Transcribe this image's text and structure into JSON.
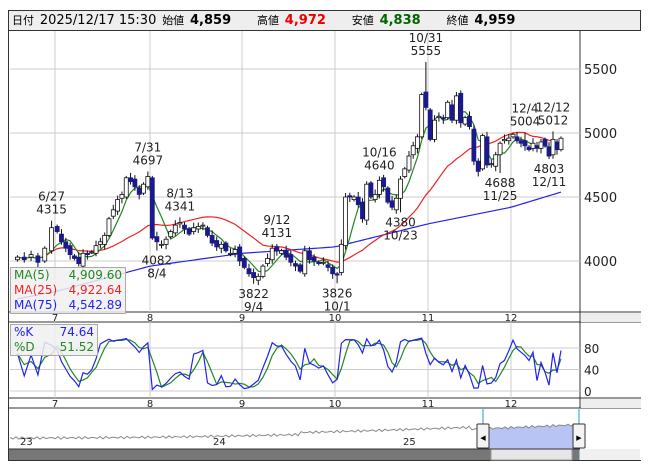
{
  "header": {
    "date_label": "日付",
    "date_value": "2025/12/17 15:30",
    "open_label": "始値",
    "open_value": "4,859",
    "high_label": "高値",
    "high_value": "4,972",
    "low_label": "安値",
    "low_value": "4,838",
    "close_label": "終値",
    "close_value": "4,959"
  },
  "colors": {
    "up_candle": "#ffffff",
    "down_candle": "#1a1a8c",
    "ma5": "#228822",
    "ma25": "#ee2222",
    "ma75": "#2222ee",
    "stoch_k": "#2222ee",
    "stoch_d": "#228822",
    "high_value": "#ee0000",
    "low_value": "#006600",
    "navigator_fill": "#b8c4f4"
  },
  "main_legend": [
    {
      "name": "MA(5)",
      "value": "4,909.60",
      "color": "#228822"
    },
    {
      "name": "MA(25)",
      "value": "4,922.64",
      "color": "#ee2222"
    },
    {
      "name": "MA(75)",
      "value": "4,542.89",
      "color": "#2222ee"
    }
  ],
  "stoch_legend": [
    {
      "name": "%K",
      "value": "74.64",
      "color": "#2222ee"
    },
    {
      "name": "%D",
      "value": "51.52",
      "color": "#228822"
    }
  ],
  "price_axis": {
    "ticks": [
      4000,
      4500,
      5000,
      5500
    ],
    "labels": [
      "4000",
      "4500",
      "5000",
      "5500"
    ]
  },
  "stoch_axis": {
    "ticks": [
      0,
      40,
      80
    ],
    "labels": [
      "0",
      "40",
      "80"
    ]
  },
  "month_labels": [
    "7",
    "8",
    "9",
    "10",
    "11",
    "12"
  ],
  "navigator": {
    "year_labels": [
      "23",
      "24",
      "25"
    ]
  },
  "chart_data": {
    "type": "candlestick",
    "months": [
      {
        "month": "6",
        "closes": [
          4030,
          4010,
          4050,
          3990,
          4100,
          4260
        ]
      },
      {
        "month": "7",
        "closes": [
          4230,
          4150,
          4100,
          4050,
          4020,
          3980,
          4060,
          4050,
          4070,
          4120,
          4150,
          4200,
          4330,
          4400,
          4480,
          4520,
          4650,
          4620,
          4580,
          4520,
          4600,
          4660
        ]
      },
      {
        "month": "8",
        "closes": [
          4180,
          4150,
          4130,
          4170,
          4230,
          4280,
          4300,
          4250,
          4210,
          4260,
          4270,
          4280,
          4200,
          4140,
          4110,
          4130,
          4080,
          4060,
          4090,
          4000
        ]
      },
      {
        "month": "9",
        "closes": [
          3950,
          3900,
          3870,
          3880,
          3960,
          4020,
          4100,
          4080,
          4080,
          4030,
          3990,
          3960,
          3920,
          4080,
          4010,
          4000,
          3980,
          3990,
          3950,
          3900
        ]
      },
      {
        "month": "10",
        "closes": [
          3890,
          4130,
          4500,
          4500,
          4500,
          4440,
          4330,
          4600,
          4500,
          4520,
          4630,
          4580,
          4460,
          4420,
          4490,
          4640,
          4720,
          4820,
          4900,
          4970,
          5300,
          5200
        ]
      },
      {
        "month": "11",
        "closes": [
          4950,
          5100,
          5130,
          5110,
          5240,
          5100,
          5290,
          5080,
          5120,
          5050,
          4780,
          4700,
          4980,
          4750,
          4760,
          4830,
          4920,
          4950,
          4960
        ]
      },
      {
        "month": "12",
        "closes": [
          4990,
          4940,
          4920,
          4900,
          4870,
          4920,
          4880,
          4930,
          4900,
          4820,
          4950,
          4870,
          4959
        ]
      }
    ],
    "ma75_anchors": [
      3700,
      3760,
      3960,
      4060,
      4110,
      4290,
      4420,
      4543
    ],
    "annotations": [
      {
        "month": "6",
        "day_index": 5,
        "date": "6/27",
        "value": "4315",
        "kind": "high"
      },
      {
        "month": "7",
        "day_index": 21,
        "date": "7/31",
        "value": "4697",
        "kind": "high"
      },
      {
        "month": "8",
        "day_index": 1,
        "date": "8/4",
        "value": "4082",
        "kind": "low"
      },
      {
        "month": "8",
        "day_index": 6,
        "date": "8/13",
        "value": "4341",
        "kind": "high"
      },
      {
        "month": "9",
        "day_index": 2,
        "date": "9/4",
        "value": "3822",
        "kind": "low"
      },
      {
        "month": "9",
        "day_index": 7,
        "date": "9/12",
        "value": "4131",
        "kind": "high"
      },
      {
        "month": "10",
        "day_index": 0,
        "date": "10/1",
        "value": "3826",
        "kind": "low"
      },
      {
        "month": "10",
        "day_index": 10,
        "date": "10/16",
        "value": "4640",
        "kind": "high"
      },
      {
        "month": "10",
        "day_index": 15,
        "date": "10/23",
        "value": "4380",
        "kind": "low"
      },
      {
        "month": "10",
        "day_index": 21,
        "date": "10/31",
        "value": "5555",
        "kind": "high"
      },
      {
        "month": "11",
        "day_index": 16,
        "date": "11/25",
        "value": "4688",
        "kind": "low"
      },
      {
        "month": "12",
        "day_index": 3,
        "date": "12/4",
        "value": "5004",
        "kind": "high"
      },
      {
        "month": "12",
        "day_index": 9,
        "date": "12/11",
        "value": "4803",
        "kind": "low"
      },
      {
        "month": "12",
        "day_index": 10,
        "date": "12/12",
        "value": "5012",
        "kind": "high"
      }
    ]
  }
}
